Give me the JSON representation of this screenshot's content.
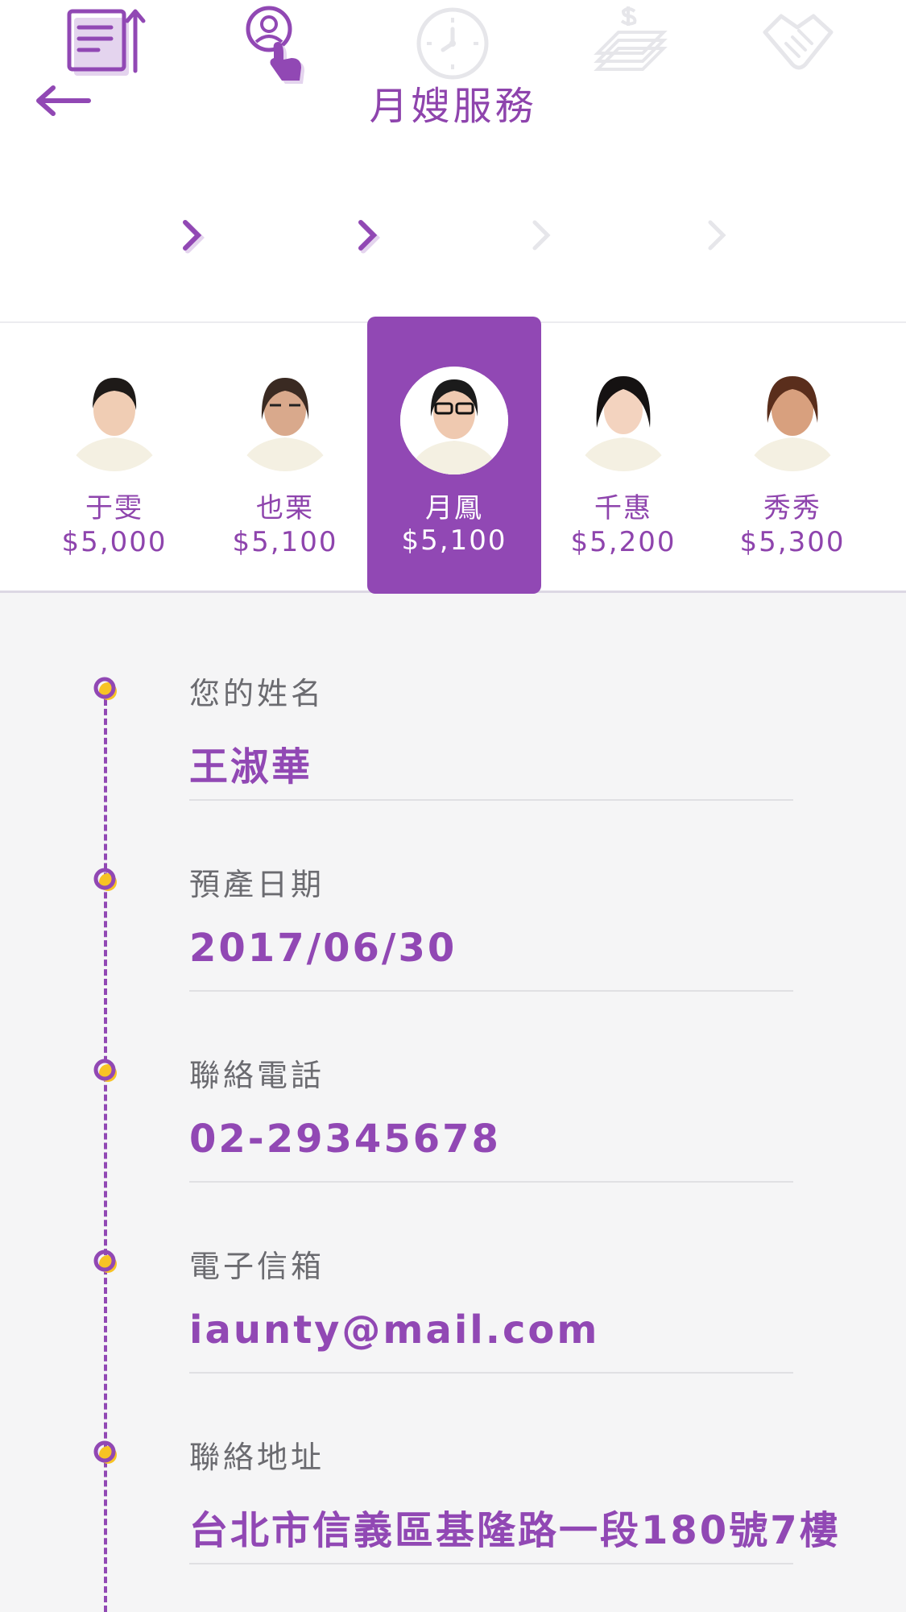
{
  "header": {
    "title": "月嫂服務",
    "back_icon": "arrow-left-icon",
    "accent_color": "#9148b4"
  },
  "steps": [
    {
      "icon": "document-upload-icon",
      "state": "done"
    },
    {
      "icon": "select-person-icon",
      "state": "active"
    },
    {
      "icon": "clock-icon",
      "state": "pending"
    },
    {
      "icon": "money-stack-icon",
      "state": "pending"
    },
    {
      "icon": "handshake-icon",
      "state": "pending"
    }
  ],
  "aunties": [
    {
      "name": "于雯",
      "price": "$5,000",
      "selected": false
    },
    {
      "name": "也栗",
      "price": "$5,100",
      "selected": false
    },
    {
      "name": "月鳳",
      "price": "$5,100",
      "selected": true
    },
    {
      "name": "千惠",
      "price": "$5,200",
      "selected": false
    },
    {
      "name": "秀秀",
      "price": "$5,300",
      "selected": false
    }
  ],
  "form": {
    "name": {
      "label": "您的姓名",
      "value": "王淑華"
    },
    "due_date": {
      "label": "預產日期",
      "value": "2017/06/30"
    },
    "phone": {
      "label": "聯絡電話",
      "value": "02-29345678"
    },
    "email": {
      "label": "電子信箱",
      "value": "iaunty@mail.com"
    },
    "address": {
      "label": "聯絡地址",
      "value": "台北市信義區基隆路一段180號7樓"
    }
  }
}
